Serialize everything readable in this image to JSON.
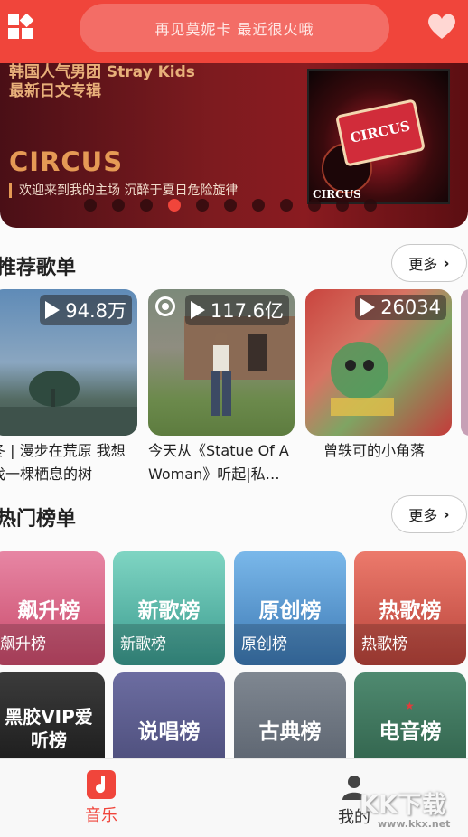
{
  "header": {
    "search_placeholder": "再见莫妮卡 最近很火哦",
    "left_icon": "apps-grid-icon",
    "right_icon": "heart-icon"
  },
  "banner": {
    "subtitle": "韩国人气男团 Stray Kids\n最新日文专辑",
    "title": "CIRCUS",
    "description": "欢迎来到我的主场 沉醉于夏日危险旋律",
    "album_plate_text": "CIRCUS",
    "album_label": "CIRCUS",
    "dot_count": 11,
    "active_dot": 3
  },
  "recommend": {
    "title": "推荐歌单",
    "more_label": "更多",
    "playlists": [
      {
        "count": "94.8万",
        "name": "冬 | 漫步在荒原 我想找一棵栖息的树"
      },
      {
        "count": "117.6亿",
        "name": "今天从《Statue Of A Woman》听起|私…"
      },
      {
        "count": "26034",
        "name": "曾轶可的小角落"
      }
    ]
  },
  "hot_charts": {
    "title": "热门榜单",
    "more_label": "更多",
    "cards": [
      {
        "big": "飙升榜",
        "label": "飙升榜",
        "color": "#d9607e"
      },
      {
        "big": "新歌榜",
        "label": "新歌榜",
        "color": "#4fb1a3"
      },
      {
        "big": "原创榜",
        "label": "原创榜",
        "color": "#4d8ecb"
      },
      {
        "big": "热歌榜",
        "label": "热歌榜",
        "color": "#d2554a"
      },
      {
        "big": "黑胶VIP爱听榜",
        "label": "",
        "color": "#2a2a2a"
      },
      {
        "big": "说唱榜",
        "label": "",
        "color": "#4e4e78"
      },
      {
        "big": "古典榜",
        "label": "",
        "color": "#5a6270"
      },
      {
        "big": "电音榜",
        "label": "",
        "color": "#2f6a54"
      }
    ]
  },
  "bottom_nav": {
    "items": [
      {
        "label": "音乐",
        "icon": "music-note-icon",
        "active": true
      },
      {
        "label": "我的",
        "icon": "user-icon",
        "active": false
      }
    ],
    "accent": "#f0453b"
  },
  "watermark": {
    "text": "KK下载",
    "url": "www.kkx.net"
  }
}
